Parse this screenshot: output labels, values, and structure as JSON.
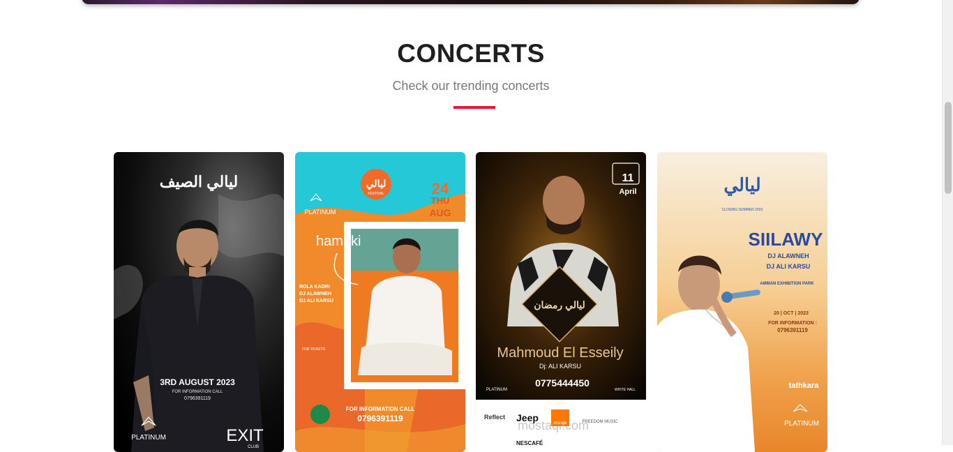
{
  "section": {
    "title": "CONCERTS",
    "subtitle": "Check our trending concerts"
  },
  "colors": {
    "accent": "#e8173c",
    "title": "#1f1f1f",
    "subtitle": "#777777"
  },
  "concerts": [
    {
      "logo": "ليالي الصيف",
      "date_line": "3RD AUGUST 2023",
      "info_label": "FOR INFORMATION CALL",
      "phone": "0796391119",
      "brand": "PLATINUM",
      "venue": "EXIT",
      "venue_sub": "CLUB"
    },
    {
      "logo": "ليالي",
      "festival_label": "FESTIVAL",
      "day": "24",
      "weekday": "THU",
      "month": "AUG",
      "brand": "PLATINUM",
      "artist": "hamaki",
      "djs": [
        "ROLA KADRI",
        "DJ ALAWNEH",
        "DJ ALI KARSU"
      ],
      "tickets_label": "FOR TICKETS",
      "info_label": "FOR INFORMATION CALL",
      "phone": "0796391119"
    },
    {
      "day": "11",
      "month": "April",
      "logo": "ليالي رمضان",
      "artist": "Mahmoud El Esseily",
      "dj": "Dj: ALI KARSU",
      "phone": "0775444450",
      "brand": "PLATINUM",
      "venue": "WHITE HALL",
      "sponsors": [
        "Reflect",
        "Jeep",
        "orange",
        "FREEDOM MUSIC",
        "NESCAFÉ"
      ],
      "watermark": "mostaql.com"
    },
    {
      "logo": "ليالي",
      "season": "CLOSING SUMMER 2023",
      "artist": "SIILAWY",
      "djs": [
        "DJ ALAWNEH",
        "DJ ALI KARSU"
      ],
      "location": "AMMAN EXHIBITION PARK",
      "date_line": "20 | OCT | 2023",
      "info_label": "FOR INFORMATION :",
      "phone": "0796391119",
      "ticketing": "tathkara",
      "brand": "PLATINUM"
    }
  ]
}
